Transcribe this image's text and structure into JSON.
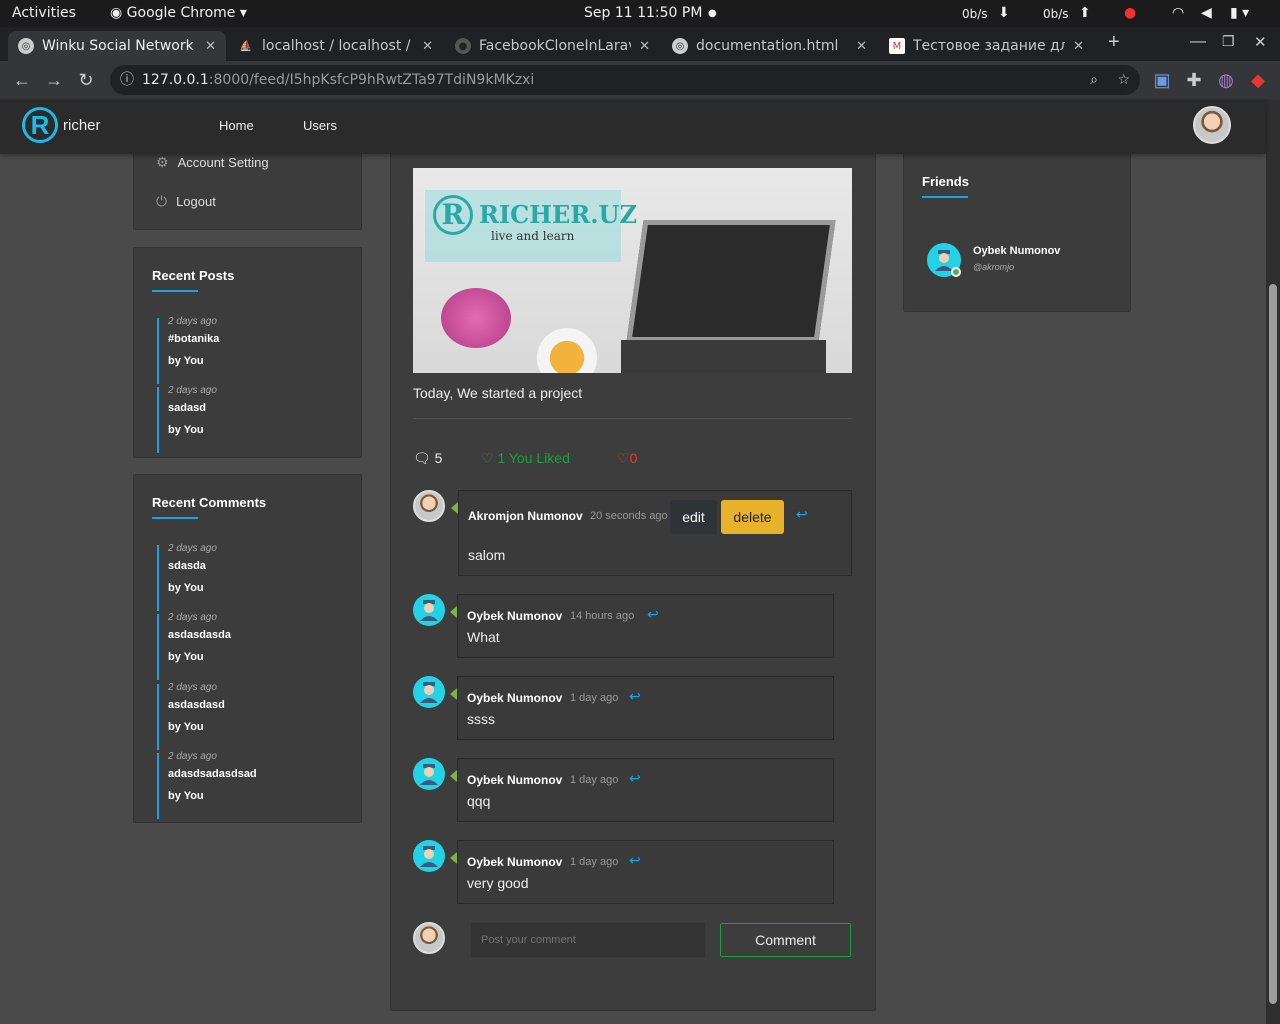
{
  "gnome": {
    "activities": "Activities",
    "app": "Google Chrome",
    "clock": "Sep 11  11:50 PM",
    "net_down": "0b/s",
    "net_up": "0b/s"
  },
  "tabs": [
    {
      "title": "Winku Social Network",
      "active": true
    },
    {
      "title": "localhost / localhost / l",
      "active": false
    },
    {
      "title": "FacebookCloneInLarav",
      "active": false
    },
    {
      "title": "documentation.html",
      "active": false
    },
    {
      "title": "Тестовое задание для",
      "active": false
    }
  ],
  "toolbar": {
    "url_host": "127.0.0.1",
    "url_path": ":8000/feed/I5hpKsfcP9hRwtZTa97TdiN9kMKzxi"
  },
  "header": {
    "logo_text": "richer",
    "nav": [
      "Home",
      "Users"
    ]
  },
  "left": {
    "menu": [
      {
        "label": "Account Setting",
        "icon": "gear-icon"
      },
      {
        "label": "Logout",
        "icon": "power-icon"
      }
    ],
    "recent_posts_title": "Recent Posts",
    "recent_posts": [
      {
        "ago": "2 days ago",
        "title": "#botanika",
        "by": "by You"
      },
      {
        "ago": "2 days ago",
        "title": "sadasd",
        "by": "by You"
      }
    ],
    "recent_comments_title": "Recent Comments",
    "recent_comments": [
      {
        "ago": "2 days ago",
        "title": "sdasda",
        "by": "by You"
      },
      {
        "ago": "2 days ago",
        "title": "asdasdasda",
        "by": "by You"
      },
      {
        "ago": "2 days ago",
        "title": "asdasdasd",
        "by": "by You"
      },
      {
        "ago": "2 days ago",
        "title": "adasdsadasdsad",
        "by": "by You"
      }
    ]
  },
  "post": {
    "image_brand": "RICHER.UZ",
    "image_tagline": "live and learn",
    "text": "Today, We started a project",
    "comments_count": "5",
    "likes_text": "1 You Liked",
    "dislikes": "0",
    "comments": [
      {
        "author": "Akromjon Numonov",
        "time": "20 seconds ago",
        "text": "salom",
        "edit": "edit",
        "delete": "delete"
      },
      {
        "author": "Oybek Numonov",
        "time": "14 hours ago",
        "text": "What"
      },
      {
        "author": "Oybek Numonov",
        "time": "1 day ago",
        "text": "ssss"
      },
      {
        "author": "Oybek Numonov",
        "time": "1 day ago",
        "text": "qqq"
      },
      {
        "author": "Oybek Numonov",
        "time": "1 day ago",
        "text": "very good"
      }
    ],
    "comment_placeholder": "Post your comment",
    "comment_button": "Comment"
  },
  "right": {
    "friends_title": "Friends",
    "friend_name": "Oybek Numonov",
    "friend_handle": "@akromjo"
  },
  "colors": {
    "accent": "#1aa3e0",
    "delete": "#e8b22a",
    "like": "#1e9e3e",
    "dislike": "#e53935",
    "online": "#4caf50"
  }
}
